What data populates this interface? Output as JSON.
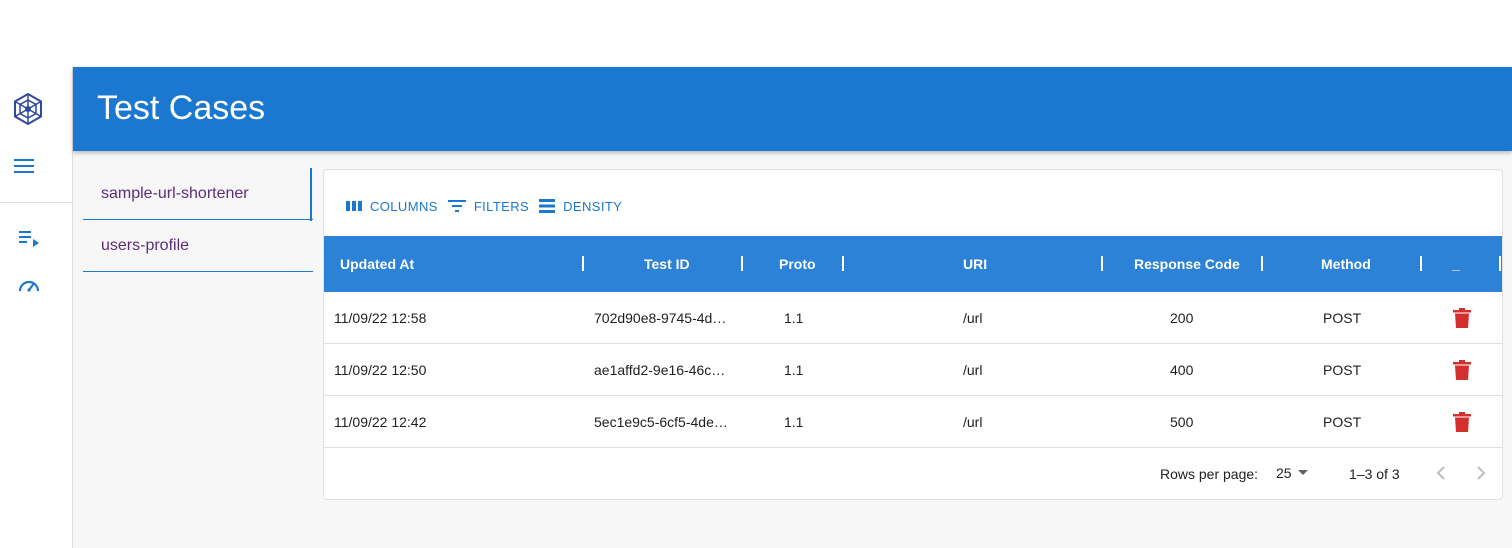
{
  "header": {
    "title": "Test Cases"
  },
  "sidebar": {
    "icons": [
      "network-logo-icon",
      "menu-icon",
      "playlist-play-icon",
      "speedometer-icon"
    ]
  },
  "tabs": [
    {
      "label": "sample-url-shortener",
      "selected": true
    },
    {
      "label": "users-profile",
      "selected": false
    }
  ],
  "toolbar": {
    "columns": "COLUMNS",
    "filters": "FILTERS",
    "density": "DENSITY"
  },
  "table": {
    "columns": [
      "Updated At",
      "Test ID",
      "Proto",
      "URI",
      "Response Code",
      "Method",
      "_"
    ],
    "rows": [
      {
        "updated_at": "11/09/22 12:58",
        "test_id": "702d90e8-9745-4d…",
        "proto": "1.1",
        "uri": "/url",
        "code": "200",
        "method": "POST"
      },
      {
        "updated_at": "11/09/22 12:50",
        "test_id": "ae1affd2-9e16-46c…",
        "proto": "1.1",
        "uri": "/url",
        "code": "400",
        "method": "POST"
      },
      {
        "updated_at": "11/09/22 12:42",
        "test_id": "5ec1e9c5-6cf5-4de…",
        "proto": "1.1",
        "uri": "/url",
        "code": "500",
        "method": "POST"
      }
    ]
  },
  "footer": {
    "rows_per_page_label": "Rows per page:",
    "rows_per_page_value": "25",
    "range": "1–3 of 3"
  },
  "colors": {
    "primary": "#1b78d0",
    "header_row": "#2c82d6",
    "delete": "#d32f2f",
    "tab_text": "#5c2d7a"
  }
}
